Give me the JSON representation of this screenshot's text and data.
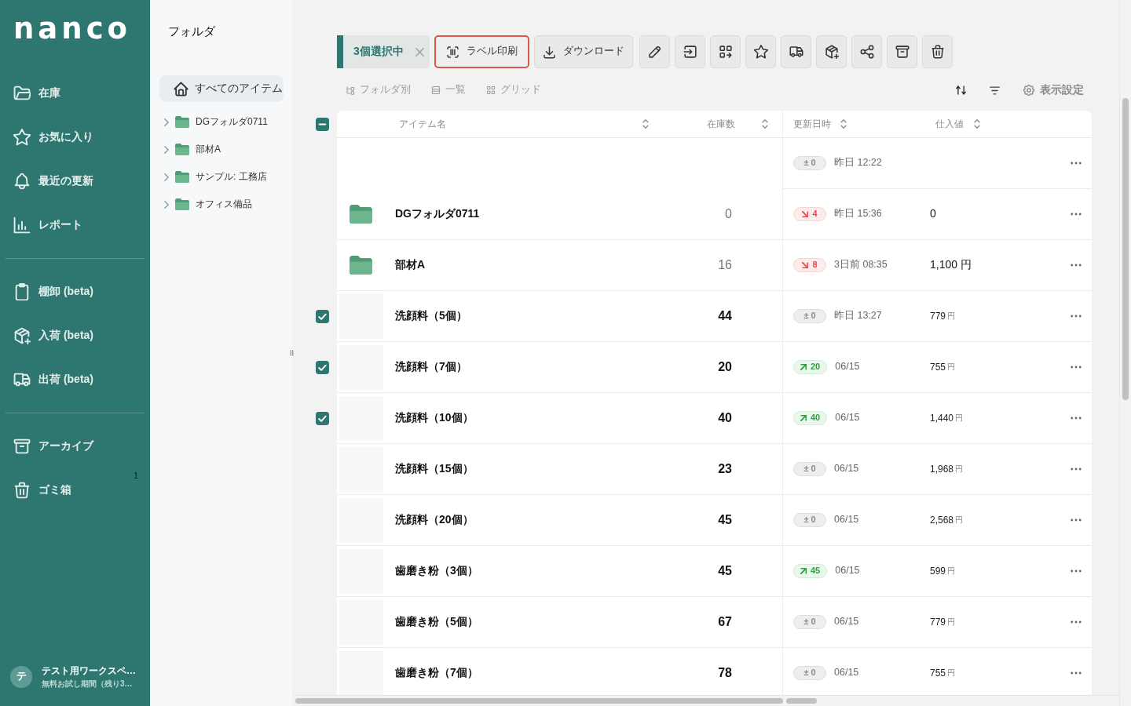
{
  "sidebar": {
    "logo": "nanco",
    "sections": [
      [
        {
          "label": "在庫"
        },
        {
          "label": "お気に入り"
        },
        {
          "label": "最近の更新"
        },
        {
          "label": "レポート"
        }
      ],
      [
        {
          "label": "棚卸 (beta)"
        },
        {
          "label": "入荷 (beta)"
        },
        {
          "label": "出荷 (beta)"
        }
      ],
      [
        {
          "label": "アーカイブ"
        },
        {
          "label": "ゴミ箱",
          "count": "1"
        }
      ]
    ],
    "workspace": {
      "avatar": "テ",
      "name": "テスト用ワークスペ…",
      "plan": "無料お試し期間（残り3…"
    }
  },
  "folder_panel": {
    "title": "フォルダ",
    "items": [
      {
        "kind": "root",
        "label": "すべてのアイテム",
        "selected": true
      },
      {
        "kind": "folder",
        "label": "DGフォルダ0711",
        "selected": false,
        "expanded": false
      },
      {
        "kind": "folder",
        "label": "部材A",
        "selected": false,
        "expanded": false
      },
      {
        "kind": "folder",
        "label": "サンプル: 工務店",
        "selected": false,
        "expanded": false
      },
      {
        "kind": "folder",
        "label": "オフィス備品",
        "selected": false,
        "expanded": false
      }
    ]
  },
  "toolbar": {
    "selection": "3個選択中",
    "buttons": [
      {
        "label": "ラベル印刷",
        "focused": true
      },
      {
        "label": "ダウンロード",
        "focused": false
      }
    ]
  },
  "view_options": [
    {
      "label": "フォルダ別"
    },
    {
      "label": "一覧"
    },
    {
      "label": "グリッド"
    }
  ],
  "display_settings": "表示設定",
  "table": {
    "select_all": {
      "checked": false,
      "indeterminate": true
    },
    "columns": [
      {
        "label": "アイテム名"
      },
      {
        "label": "在庫数"
      },
      {
        "label": "更新日時"
      },
      {
        "label": "仕入値"
      }
    ],
    "rows": [
      {
        "kind": "blank",
        "checked": false,
        "change": {
          "kind": "flat",
          "text": "± 0"
        },
        "updated": "昨日 12:22"
      },
      {
        "kind": "folder",
        "checked": false,
        "name": "DGフォルダ0711",
        "stock": "0",
        "change": {
          "kind": "down",
          "text": "4"
        },
        "updated": "昨日 15:36",
        "price": "0"
      },
      {
        "kind": "folder",
        "checked": false,
        "name": "部材A",
        "stock": "16",
        "change": {
          "kind": "down",
          "text": "8"
        },
        "updated": "3日前 08:35",
        "price": "1,100",
        "currency": "円"
      },
      {
        "kind": "item",
        "checked": true,
        "name": "洗顔料（5個）",
        "stock": "44",
        "change": {
          "kind": "flat",
          "text": "± 0"
        },
        "updated": "昨日 13:27",
        "price": "779",
        "currency": "円"
      },
      {
        "kind": "item",
        "checked": true,
        "name": "洗顔料（7個）",
        "stock": "20",
        "change": {
          "kind": "up",
          "text": "20"
        },
        "updated": "06/15",
        "price": "755",
        "currency": "円"
      },
      {
        "kind": "item",
        "checked": true,
        "name": "洗顔料（10個）",
        "stock": "40",
        "change": {
          "kind": "up",
          "text": "40"
        },
        "updated": "06/15",
        "price": "1,440",
        "currency": "円"
      },
      {
        "kind": "item",
        "checked": false,
        "name": "洗顔料（15個）",
        "stock": "23",
        "change": {
          "kind": "flat",
          "text": "± 0"
        },
        "updated": "06/15",
        "price": "1,968",
        "currency": "円"
      },
      {
        "kind": "item",
        "checked": false,
        "name": "洗顔料（20個）",
        "stock": "45",
        "change": {
          "kind": "flat",
          "text": "± 0"
        },
        "updated": "06/15",
        "price": "2,568",
        "currency": "円"
      },
      {
        "kind": "item",
        "checked": false,
        "name": "歯磨き粉（3個）",
        "stock": "45",
        "change": {
          "kind": "up",
          "text": "45"
        },
        "updated": "06/15",
        "price": "599",
        "currency": "円"
      },
      {
        "kind": "item",
        "checked": false,
        "name": "歯磨き粉（5個）",
        "stock": "67",
        "change": {
          "kind": "flat",
          "text": "± 0"
        },
        "updated": "06/15",
        "price": "779",
        "currency": "円"
      },
      {
        "kind": "item",
        "checked": false,
        "name": "歯磨き粉（7個）",
        "stock": "78",
        "change": {
          "kind": "flat",
          "text": "± 0"
        },
        "updated": "06/15",
        "price": "755",
        "currency": "円"
      }
    ]
  }
}
